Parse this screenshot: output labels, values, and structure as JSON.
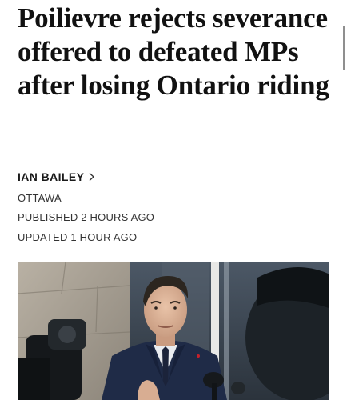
{
  "article": {
    "headline": "Poilievre rejects severance offered to defeated MPs after losing Ontario riding",
    "author": "IAN BAILEY",
    "location": "OTTAWA",
    "published": "PUBLISHED 2 HOURS AGO",
    "updated": "UPDATED 1 HOUR AGO"
  },
  "icons": {
    "byline_chevron": "chevron-right-icon"
  },
  "colors": {
    "text": "#111111",
    "divider": "#d9d9d9",
    "suit": "#1f2b47"
  }
}
